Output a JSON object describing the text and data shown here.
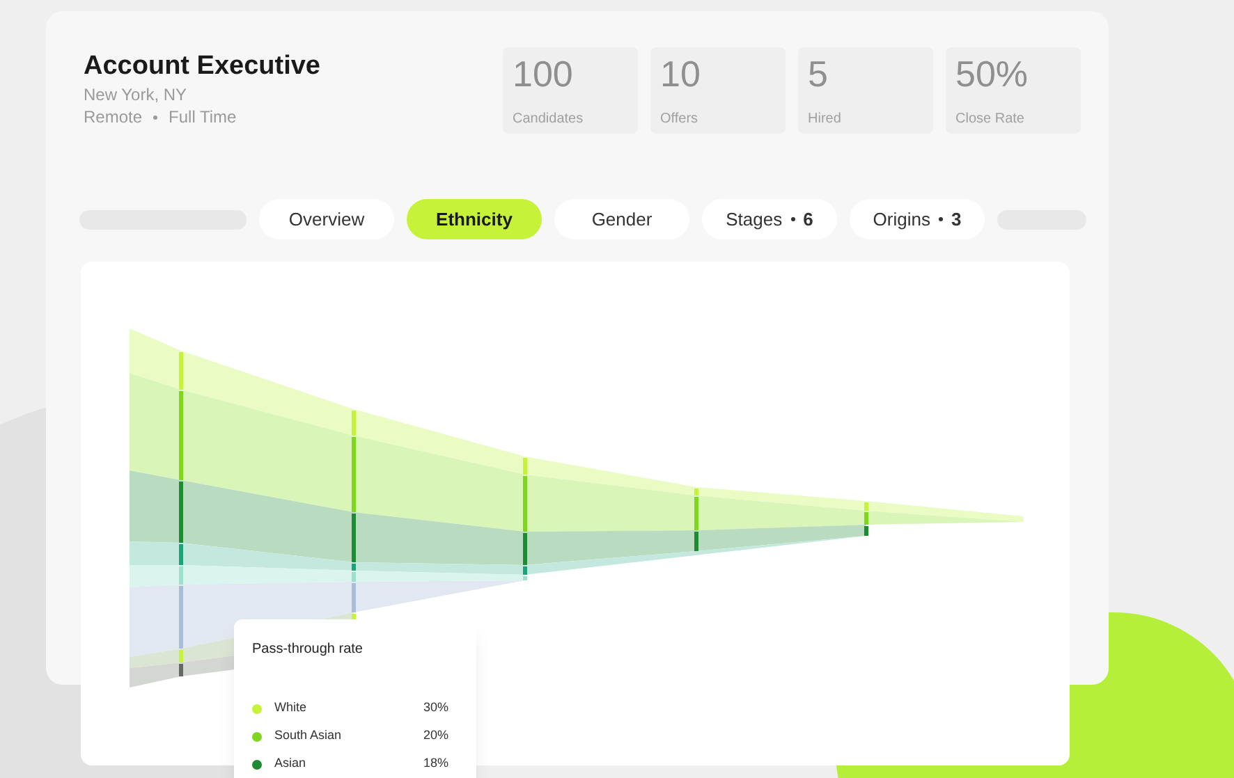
{
  "job": {
    "title": "Account Executive",
    "location": "New York, NY",
    "work_mode": "Remote",
    "employment_type": "Full Time"
  },
  "stats": [
    {
      "value": "100",
      "label": "Candidates"
    },
    {
      "value": "10",
      "label": "Offers"
    },
    {
      "value": "5",
      "label": "Hired"
    },
    {
      "value": "50%",
      "label": "Close Rate"
    }
  ],
  "tabs": [
    {
      "label": "Overview",
      "selected": false
    },
    {
      "label": "Ethnicity",
      "selected": true
    },
    {
      "label": "Gender",
      "selected": false
    },
    {
      "label": "Stages",
      "count": "6",
      "selected": false
    },
    {
      "label": "Origins",
      "count": "3",
      "selected": false
    }
  ],
  "tooltip": {
    "title": "Pass-through rate",
    "rows": [
      {
        "label": "White",
        "value": "30%",
        "color": "#c6f23a"
      },
      {
        "label": "South Asian",
        "value": "20%",
        "color": "#7fd621"
      },
      {
        "label": "Asian",
        "value": "18%",
        "color": "#1e8a34"
      }
    ]
  }
}
